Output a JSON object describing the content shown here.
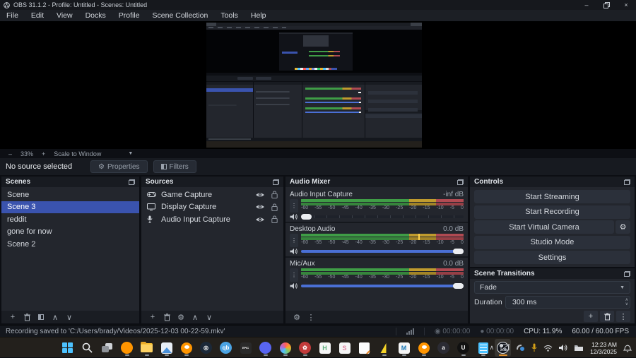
{
  "window": {
    "title": "OBS 31.1.2 - Profile: Untitled - Scenes: Untitled",
    "minimize": "–",
    "maximize": "restore",
    "close": "×"
  },
  "menu": {
    "items": [
      "File",
      "Edit",
      "View",
      "Docks",
      "Profile",
      "Scene Collection",
      "Tools",
      "Help"
    ]
  },
  "preview_toolbar": {
    "zoom_out": "–",
    "zoom_value": "33%",
    "zoom_in": "+",
    "scale_mode": "Scale to Window",
    "caret": "▼"
  },
  "source_toolbar": {
    "status": "No source selected",
    "properties_label": "Properties",
    "filters_label": "Filters"
  },
  "scenes": {
    "title": "Scenes",
    "items": [
      {
        "label": "Scene",
        "selected": false
      },
      {
        "label": "Scene 3",
        "selected": true
      },
      {
        "label": "reddit",
        "selected": false
      },
      {
        "label": "gone for now",
        "selected": false
      },
      {
        "label": "Scene 2",
        "selected": false
      }
    ]
  },
  "sources": {
    "title": "Sources",
    "items": [
      {
        "label": "Game Capture",
        "icon": "gamepad-icon"
      },
      {
        "label": "Display Capture",
        "icon": "display-icon"
      },
      {
        "label": "Audio Input Capture",
        "icon": "mic-icon"
      }
    ]
  },
  "audio_mixer": {
    "title": "Audio Mixer",
    "ticks": [
      "-60",
      "-55",
      "-50",
      "-45",
      "-40",
      "-35",
      "-30",
      "-25",
      "-20",
      "-15",
      "-10",
      "-5",
      "0"
    ],
    "channels": [
      {
        "name": "Audio Input Capture",
        "level": "-inf dB",
        "volume": 0,
        "peak": null
      },
      {
        "name": "Desktop Audio",
        "level": "0.0 dB",
        "volume": 100,
        "peak": 72
      },
      {
        "name": "Mic/Aux",
        "level": "0.0 dB",
        "volume": 100,
        "peak": null
      }
    ]
  },
  "controls": {
    "title": "Controls",
    "buttons": [
      {
        "label": "Start Streaming",
        "gear": false
      },
      {
        "label": "Start Recording",
        "gear": false
      },
      {
        "label": "Start Virtual Camera",
        "gear": true
      },
      {
        "label": "Studio Mode",
        "gear": false
      },
      {
        "label": "Settings",
        "gear": false
      }
    ],
    "gear_glyph": "⚙"
  },
  "transitions": {
    "title": "Scene Transitions",
    "selected": "Fade",
    "duration_label": "Duration",
    "duration_value": "300 ms"
  },
  "status_bar": {
    "message": "Recording saved to 'C:/Users/brady/Videos/2025-12-03 00-22-59.mkv'",
    "stream_time": "00:00:00",
    "record_time": "00:00:00",
    "cpu": "CPU: 11.9%",
    "fps": "60.00 / 60.00 FPS"
  },
  "taskbar": {
    "icons": [
      {
        "name": "start-button",
        "kind": "win",
        "indicator": false,
        "active": false
      },
      {
        "name": "search-icon",
        "kind": "search",
        "indicator": false,
        "active": false
      },
      {
        "name": "task-view-icon",
        "kind": "taskview",
        "indicator": false,
        "active": false
      },
      {
        "name": "firefox-icon",
        "kind": "circle",
        "color": "#ff9500",
        "letter": "",
        "indicator": true,
        "active": false
      },
      {
        "name": "file-explorer-icon",
        "kind": "folder",
        "indicator": true,
        "active": false
      },
      {
        "name": "photos-icon",
        "kind": "photos",
        "indicator": true,
        "active": false
      },
      {
        "name": "blender-icon",
        "kind": "blender",
        "indicator": true,
        "active": false
      },
      {
        "name": "steam-icon",
        "kind": "circle",
        "color": "#1b2838",
        "letter": "◎",
        "indicator": false,
        "active": false
      },
      {
        "name": "qbittorrent-icon",
        "kind": "circle",
        "color": "#4ba3e3",
        "letter": "qb",
        "indicator": false,
        "active": false
      },
      {
        "name": "epic-games-icon",
        "kind": "epic",
        "letter": "EPIC",
        "indicator": false,
        "active": false
      },
      {
        "name": "discord-icon",
        "kind": "circle",
        "color": "#5865F2",
        "letter": "",
        "indicator": true,
        "active": false
      },
      {
        "name": "davinci-resolve-icon",
        "kind": "resolve",
        "indicator": true,
        "active": false
      },
      {
        "name": "krita-icon",
        "kind": "circle",
        "color": "#c23b3b",
        "letter": "✿",
        "indicator": true,
        "active": false
      },
      {
        "name": "h-app-icon",
        "kind": "card",
        "color": "#5fae7c",
        "letter": "H",
        "indicator": false,
        "active": false
      },
      {
        "name": "s-app-icon",
        "kind": "card",
        "color": "#e087a3",
        "letter": "S",
        "indicator": false,
        "active": false
      },
      {
        "name": "notes-icon",
        "kind": "notes",
        "indicator": false,
        "active": false
      },
      {
        "name": "lightning-app-icon",
        "kind": "bolt",
        "indicator": true,
        "active": false
      },
      {
        "name": "maya-icon",
        "kind": "card",
        "color": "#1a78b5",
        "letter": "M",
        "indicator": true,
        "active": false
      },
      {
        "name": "blender-icon-2",
        "kind": "blender",
        "indicator": true,
        "active": false
      },
      {
        "name": "audacity-icon",
        "kind": "circle",
        "color": "#2b2b33",
        "letter": "a",
        "indicator": false,
        "active": false
      },
      {
        "name": "unreal-engine-icon",
        "kind": "circle",
        "color": "#111111",
        "letter": "U",
        "indicator": true,
        "active": false
      },
      {
        "name": "notepad-icon",
        "kind": "notepad",
        "indicator": true,
        "active": false
      },
      {
        "name": "obs-taskbar-icon",
        "kind": "obs",
        "indicator": true,
        "active": true
      }
    ],
    "tray": [
      {
        "name": "tray-chevron-icon",
        "glyph": "∧"
      },
      {
        "name": "cast-disabled-icon",
        "glyph": "⊘"
      },
      {
        "name": "bluetooth-device-icon",
        "glyph": "☾"
      },
      {
        "name": "gold-mic-icon",
        "glyph": "⚲"
      },
      {
        "name": "wifi-icon",
        "glyph": ""
      },
      {
        "name": "volume-icon",
        "glyph": ""
      },
      {
        "name": "folder-tray-icon",
        "glyph": ""
      }
    ],
    "clock": {
      "time": "12:23 AM",
      "date": "12/3/2025"
    }
  },
  "colors": {
    "accent_blue": "#3a53ae",
    "meter_green": "#3f9d46",
    "meter_yellow": "#c09b2e",
    "meter_red": "#b04a52",
    "slider_blue": "#4a6fd4",
    "taskbar_active_underline": "#e0902a"
  }
}
